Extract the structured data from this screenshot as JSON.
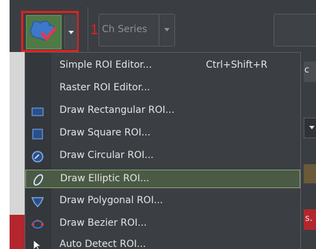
{
  "toolbar": {
    "callout_number": "1",
    "ch_series_label": "Ch Series",
    "right_stub_letter": "c"
  },
  "menu": {
    "items": [
      {
        "label": "Simple ROI Editor...",
        "shortcut": "Ctrl+Shift+R",
        "icon": "none",
        "highlighted": false
      },
      {
        "label": "Raster ROI Editor...",
        "shortcut": "",
        "icon": "none",
        "highlighted": false
      },
      {
        "label": "Draw Rectangular ROI...",
        "shortcut": "",
        "icon": "rectangle-icon",
        "highlighted": false
      },
      {
        "label": "Draw Square ROI...",
        "shortcut": "",
        "icon": "square-icon",
        "highlighted": false
      },
      {
        "label": "Draw Circular ROI...",
        "shortcut": "",
        "icon": "circle-icon",
        "highlighted": false
      },
      {
        "label": "Draw Elliptic ROI...",
        "shortcut": "",
        "icon": "ellipse-icon",
        "highlighted": true
      },
      {
        "label": "Draw Polygonal ROI...",
        "shortcut": "",
        "icon": "polygon-icon",
        "highlighted": false
      },
      {
        "label": "Draw Bezier ROI...",
        "shortcut": "",
        "icon": "bezier-icon",
        "highlighted": false
      },
      {
        "label": "Auto Detect ROI...",
        "shortcut": "",
        "icon": "cursor-icon",
        "highlighted": false
      }
    ]
  },
  "side": {
    "right_text_s": "s."
  },
  "colors": {
    "accent_red": "#e02020",
    "menu_bg": "#3b3f43",
    "highlight_bg": "#4a5a45",
    "highlight_border": "#8fa57a",
    "icon_blue": "#3e79c9"
  }
}
